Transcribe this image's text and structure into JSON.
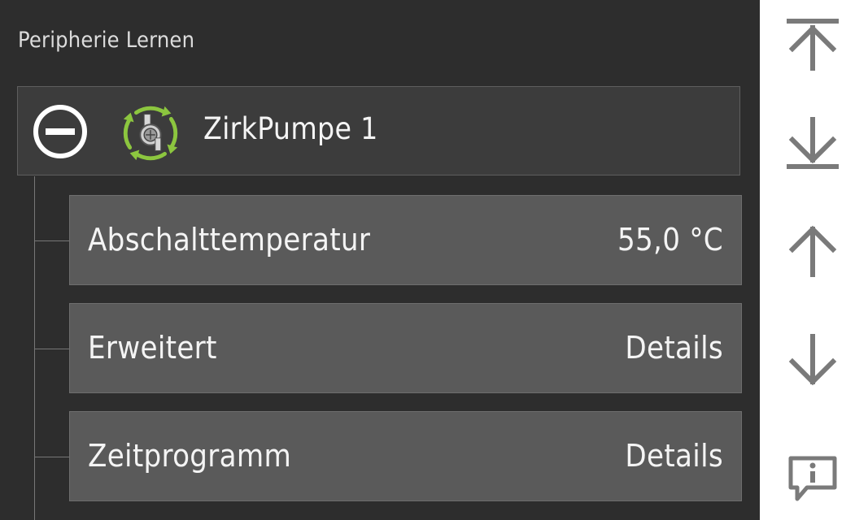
{
  "page": {
    "title": "Peripherie Lernen"
  },
  "group": {
    "label": "ZirkPumpe 1",
    "collapse_icon": "minus-circle-icon",
    "device_icon": "circulation-pump-icon"
  },
  "rows": [
    {
      "label": "Abschalttemperatur",
      "value": "55,0 °C"
    },
    {
      "label": "Erweitert",
      "value": "Details"
    },
    {
      "label": "Zeitprogramm",
      "value": "Details"
    }
  ],
  "sidebar": {
    "buttons": [
      {
        "icon": "scroll-to-top-icon"
      },
      {
        "icon": "scroll-to-bottom-icon"
      },
      {
        "icon": "arrow-up-icon"
      },
      {
        "icon": "arrow-down-icon"
      },
      {
        "icon": "info-message-icon"
      }
    ],
    "icon_color": "#7a7a7a"
  },
  "colors": {
    "pump_green": "#8cc63f",
    "background": "#2d2d2d",
    "row_background": "#5a5a5a"
  }
}
